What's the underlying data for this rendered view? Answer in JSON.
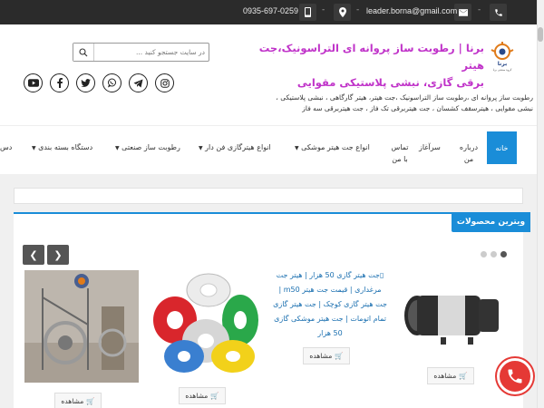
{
  "topbar": {
    "phone": "0935-697-0259",
    "email": "leader.borna@gmail.com",
    "separator": "-"
  },
  "header": {
    "title_line1": "برنا | رطوبت ساز پروانه ای التراسونیک،جت هیتر",
    "title_line2": "برقی گازی، نبشی پلاستیکی مقوایی",
    "description": "رطوبت ساز پروانه ای ،رطوبت ساز التراسونیک ،جت هیتر، هیتر گارگاهی ، نبشی پلاستیکی ، نبشی مقوایی ، هیترسقف کشسان ، جت هیتربرقی تک فاز ، جت هیتربرقی سه فاز",
    "logo_text": "برنا",
    "logo_caption": "گروه صنعتی برنا"
  },
  "search": {
    "placeholder": "در سایت جستجو کنید ..."
  },
  "social": [
    "instagram-icon",
    "telegram-icon",
    "whatsapp-icon",
    "twitter-icon",
    "facebook-icon",
    "youtube-icon"
  ],
  "nav": {
    "items": [
      {
        "label": "خانه"
      },
      {
        "label": "درباره",
        "label2": "من"
      },
      {
        "label": "سرآغاز"
      },
      {
        "label": "تماس",
        "label2": "با من"
      },
      {
        "label": "انواع جت هیتر موشکی"
      },
      {
        "label": "انواع هیترگازی فن دار"
      },
      {
        "label": "رطوبت ساز صنعتی"
      },
      {
        "label": "دستگاه بسته بندی"
      },
      {
        "label": "دس"
      }
    ]
  },
  "showcase": {
    "title": "ویترین محصولات",
    "view_label": "مشاهده",
    "broken_image_alt": "جت هیتر گازی 50 هزار | هیتر جت مرغداری | قیمت جت هیتر m50 | جت هیتر گازی کوچک | جت هیتر گازی تمام اتومات | جت هیتر موشکی گازی 50 هزار"
  },
  "colors": {
    "accent": "#1a8dd8",
    "title": "#c033c9",
    "topbar": "#2b2b2b",
    "call": "#e53935"
  }
}
